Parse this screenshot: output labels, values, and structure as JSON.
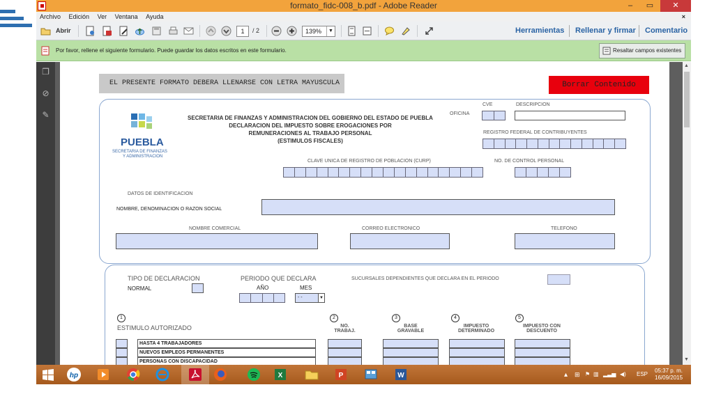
{
  "window": {
    "title": "formato_fidc-008_b.pdf - Adobe Reader",
    "minimize": "–",
    "maximize": "▭",
    "close": "✕"
  },
  "menu": [
    "Archivo",
    "Edición",
    "Ver",
    "Ventana",
    "Ayuda"
  ],
  "menu_close": "×",
  "toolbar": {
    "open_label": "Abrir",
    "page_current": "1",
    "page_total": "/ 2",
    "zoom": "139%",
    "tools": "Herramientas",
    "fill_sign": "Rellenar y firmar",
    "comment": "Comentario"
  },
  "infobar": {
    "message": "Por favor, rellene el siguiente formulario. Puede guardar los datos escritos en este formulario.",
    "highlight_button": "Resaltar campos existentes"
  },
  "form": {
    "header_notice": "EL PRESENTE FORMATO DEBERA LLENARSE CON LETRA MAYUSCULA",
    "clear_button": "Borrar Contenido",
    "org_title_1": "SECRETARIA DE FINANZAS Y ADMINISTRACION DEL GOBIERNO DEL ESTADO DE PUEBLA",
    "org_title_2": "DECLARACION DEL IMPUESTO SOBRE EROGACIONES POR",
    "org_title_3": "REMUNERACIONES AL TRABAJO PERSONAL",
    "org_title_4": "(ESTIMULOS FISCALES)",
    "logo_name": "PUEBLA",
    "logo_sub_1": "SECRETARIA DE FINANZAS",
    "logo_sub_2": "Y ADMINISTRACION",
    "oficina": "OFICINA",
    "cve": "CVE",
    "descripcion": "DESCRIPCION",
    "rfc": "REGISTRO FEDERAL DE CONTRIBUYENTES",
    "curp": "CLAVE UNICA DE REGISTRO DE POBLACION (CURP)",
    "control": "No. DE CONTROL PERSONAL",
    "datos_ident": "DATOS DE IDENTIFICACION",
    "nombre_razon": "NOMBRE, DENOMINACION O RAZON SOCIAL",
    "nombre_comercial": "NOMBRE COMERCIAL",
    "correo": "CORREO ELECTRONICO",
    "telefono": "TELEFONO",
    "tipo_decl": "TIPO DE DECLARACION",
    "normal": "NORMAL",
    "periodo": "PERIODO QUE DECLARA",
    "anio": "AÑO",
    "mes": "MES",
    "mes_value": "- -",
    "sucursales": "SUCURSALES DEPENDIENTES QUE DECLARA EN EL PERIODO",
    "col1_num": "1",
    "col1": "ESTIMULO AUTORIZADO",
    "col2_num": "2",
    "col2a": "NO.",
    "col2b": "TRABAJ.",
    "col3_num": "3",
    "col3a": "BASE",
    "col3b": "GRAVABLE",
    "col4_num": "4",
    "col4a": "IMPUESTO",
    "col4b": "DETERMINADO",
    "col5_num": "5",
    "col5a": "IMPUESTO CON",
    "col5b": "DESCUENTO",
    "rows": [
      "HASTA 4 TRABAJADORES",
      "NUEVOS EMPLEOS PERMANENTES",
      "PERSONAS CON DISCAPACIDAD"
    ]
  },
  "taskbar": {
    "lang": "ESP",
    "time": "05:37 p. m.",
    "date": "16/09/2015"
  },
  "colors": {
    "title_bar": "#f2a33c",
    "info_bar": "#b9e0a5",
    "field_fill": "#d6dff8",
    "clear_button": "#e8000d",
    "taskbar": "#b7651f"
  }
}
